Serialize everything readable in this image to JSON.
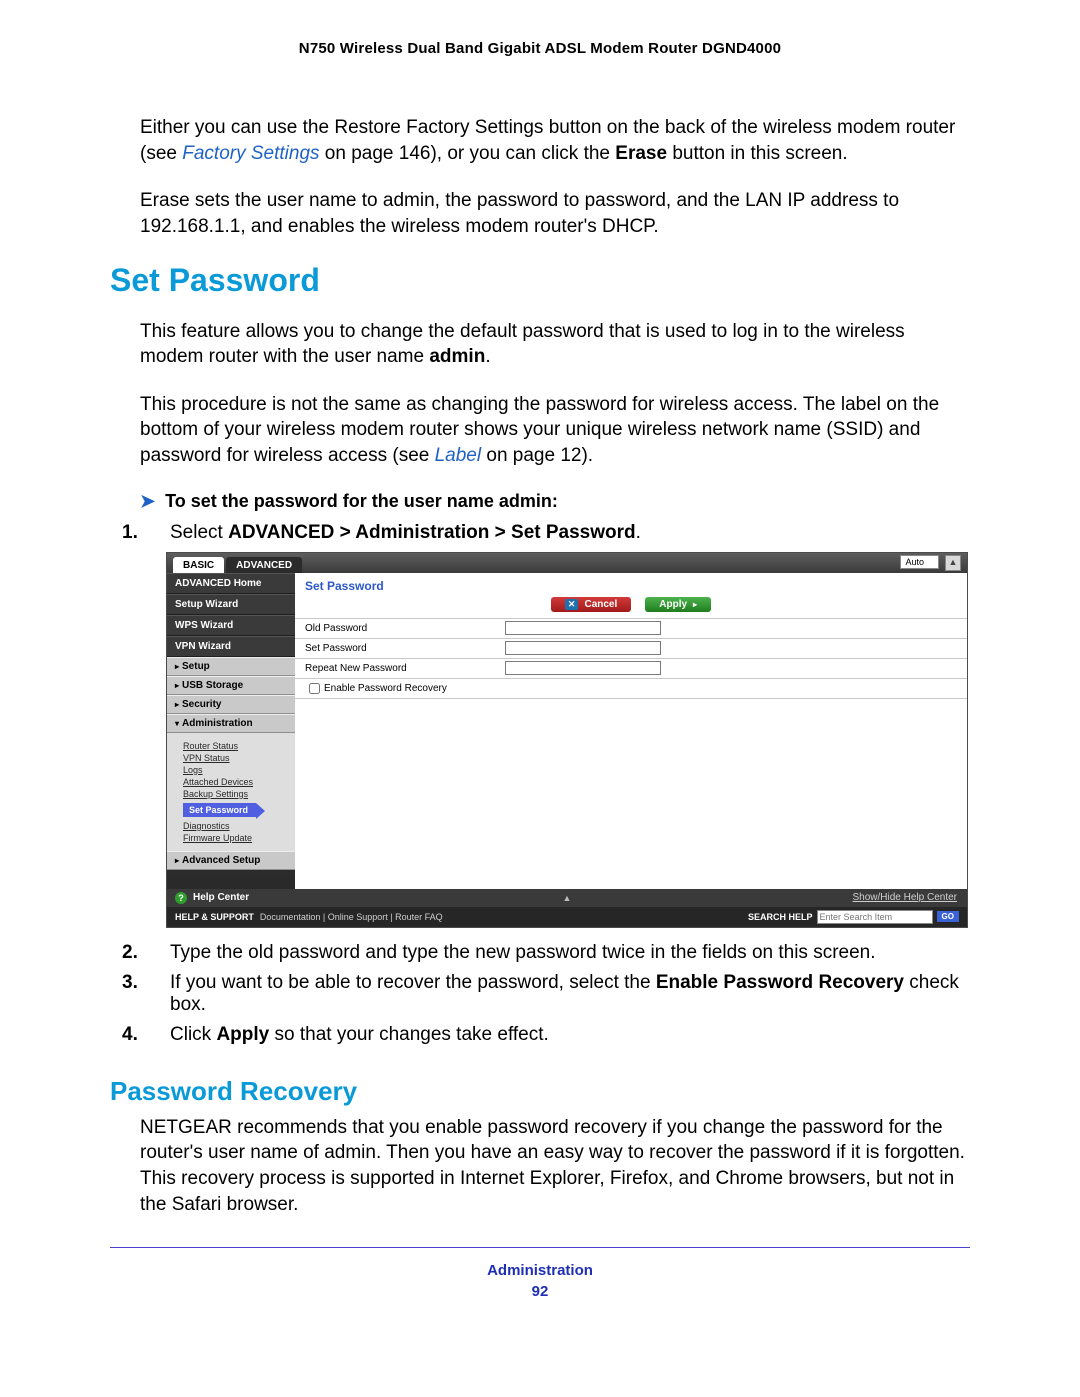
{
  "header": {
    "title": "N750 Wireless Dual Band Gigabit ADSL Modem Router DGND4000"
  },
  "intro": {
    "p1a": "Either you can use the Restore Factory Settings button on the back of the wireless modem router (see ",
    "link1": "Factory Settings",
    "p1b": " on page 146), or you can click the ",
    "bold1": "Erase",
    "p1c": " button in this screen.",
    "p2": "Erase sets the user name to admin, the password to password, and the LAN IP address to 192.168.1.1, and enables the wireless modem router's DHCP."
  },
  "sections": {
    "set_password": {
      "title": "Set Password",
      "p1a": "This feature allows you to change the default password that is used to log in to the wireless modem router with the user name ",
      "p1b": "admin",
      "p1c": ".",
      "p2a": "This procedure is not the same as changing the password for wireless access. The label on the bottom of your wireless modem router shows your unique wireless network name (SSID) and password for wireless access (see ",
      "p2link": "Label",
      "p2b": " on page 12).",
      "task": "To set the password for the user name admin:",
      "steps": {
        "s1a": "Select ",
        "s1b": "ADVANCED > Administration > Set Password",
        "s1c": ".",
        "s2": "Type the old password and type the new password twice in the fields on this screen.",
        "s3a": "If you want to be able to recover the password, select the ",
        "s3b": "Enable Password Recovery",
        "s3c": " check box.",
        "s4a": "Click ",
        "s4b": "Apply",
        "s4c": " so that your changes take effect."
      }
    },
    "password_recovery": {
      "title": "Password Recovery",
      "p1": "NETGEAR recommends that you enable password recovery if you change the password for the router's user name of admin. Then you have an easy way to recover the password if it is forgotten. This recovery process is supported in Internet Explorer, Firefox, and Chrome browsers, but not in the Safari browser."
    }
  },
  "screenshot": {
    "tabs": {
      "basic": "BASIC",
      "advanced": "ADVANCED"
    },
    "auto": "Auto",
    "sidebar": {
      "items": [
        "ADVANCED Home",
        "Setup Wizard",
        "WPS Wizard",
        "VPN Wizard"
      ],
      "subitems": [
        "Setup",
        "USB Storage",
        "Security",
        "Administration"
      ],
      "admin_links": [
        "Router Status",
        "VPN Status",
        "Logs",
        "Attached Devices",
        "Backup Settings",
        "Set Password",
        "Diagnostics",
        "Firmware Update"
      ],
      "last_sub": "Advanced Setup"
    },
    "content": {
      "title": "Set Password",
      "cancel": "Cancel",
      "apply": "Apply",
      "fields": {
        "old": "Old Password",
        "new": "Set Password",
        "rep": "Repeat New Password",
        "enable": "Enable Password Recovery"
      }
    },
    "helpbar": {
      "label": "Help Center",
      "showhide": "Show/Hide Help Center"
    },
    "support": {
      "label": "HELP & SUPPORT",
      "links": "Documentation  |  Online Support  |  Router FAQ",
      "search_label": "SEARCH HELP",
      "search_ph": "Enter Search Item",
      "go": "GO"
    }
  },
  "footer": {
    "section": "Administration",
    "page": "92"
  }
}
